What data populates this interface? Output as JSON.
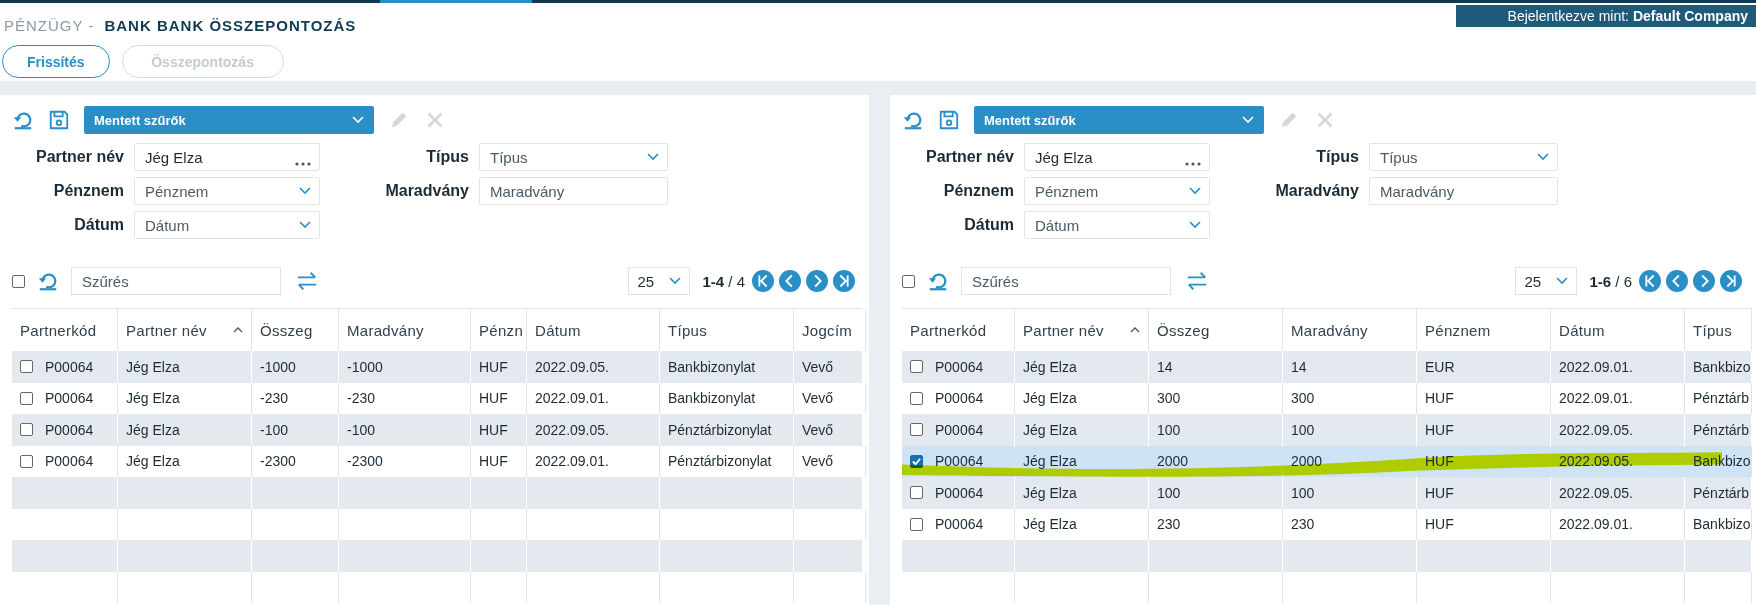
{
  "header": {
    "module": "PÉNZÜGY -",
    "title": "BANK BANK ÖSSZEPONTOZÁS",
    "login_label": "Bejelentkezve mint:",
    "login_user": "Default Company"
  },
  "actions": [
    {
      "label": "Frissítés",
      "disabled": false
    },
    {
      "label": "Összepontozás",
      "disabled": true
    }
  ],
  "panels": [
    {
      "saved_filters": "Mentett szűrők",
      "filters_left": [
        {
          "label": "Partner név",
          "value": "Jég Elza",
          "kind": "lookup"
        },
        {
          "label": "Pénznem",
          "placeholder": "Pénznem",
          "kind": "select"
        },
        {
          "label": "Dátum",
          "placeholder": "Dátum",
          "kind": "select"
        }
      ],
      "filters_right": [
        {
          "label": "Típus",
          "placeholder": "Típus",
          "kind": "select"
        },
        {
          "label": "Maradvány",
          "placeholder": "Maradvány",
          "kind": "text"
        }
      ],
      "all_checked": false,
      "search_placeholder": "Szűrés",
      "page_size": "25",
      "range": "1-4",
      "total": "/ 4",
      "columns": [
        {
          "label": "Partnerkód",
          "sorted": false
        },
        {
          "label": "Partner név",
          "sorted": true
        },
        {
          "label": "Összeg",
          "sorted": false
        },
        {
          "label": "Maradvány",
          "sorted": false
        },
        {
          "label": "Pénzn",
          "sorted": false
        },
        {
          "label": "Dátum",
          "sorted": false
        },
        {
          "label": "Típus",
          "sorted": false
        },
        {
          "label": "Jogcím",
          "sorted": false
        }
      ],
      "rows": [
        {
          "checked": false,
          "marked": false,
          "cells": [
            "P00064",
            "Jég Elza",
            "-1000",
            "-1000",
            "HUF",
            "2022.09.05.",
            "Bankbizonylat",
            "Vevő"
          ]
        },
        {
          "checked": false,
          "marked": false,
          "cells": [
            "P00064",
            "Jég Elza",
            "-230",
            "-230",
            "HUF",
            "2022.09.01.",
            "Bankbizonylat",
            "Vevő"
          ]
        },
        {
          "checked": false,
          "marked": false,
          "cells": [
            "P00064",
            "Jég Elza",
            "-100",
            "-100",
            "HUF",
            "2022.09.05.",
            "Pénztárbizonylat",
            "Vevő"
          ]
        },
        {
          "checked": false,
          "marked": false,
          "cells": [
            "P00064",
            "Jég Elza",
            "-2300",
            "-2300",
            "HUF",
            "2022.09.01.",
            "Pénztárbizonylat",
            "Vevő"
          ]
        }
      ]
    },
    {
      "saved_filters": "Mentett szűrők",
      "filters_left": [
        {
          "label": "Partner név",
          "value": "Jég Elza",
          "kind": "lookup"
        },
        {
          "label": "Pénznem",
          "placeholder": "Pénznem",
          "kind": "select"
        },
        {
          "label": "Dátum",
          "placeholder": "Dátum",
          "kind": "select"
        }
      ],
      "filters_right": [
        {
          "label": "Típus",
          "placeholder": "Típus",
          "kind": "select"
        },
        {
          "label": "Maradvány",
          "placeholder": "Maradvány",
          "kind": "text"
        }
      ],
      "all_checked": false,
      "search_placeholder": "Szűrés",
      "page_size": "25",
      "range": "1-6",
      "total": "/ 6",
      "columns": [
        {
          "label": "Partnerkód",
          "sorted": false
        },
        {
          "label": "Partner név",
          "sorted": true
        },
        {
          "label": "Összeg",
          "sorted": false
        },
        {
          "label": "Maradvány",
          "sorted": false
        },
        {
          "label": "Pénznem",
          "sorted": false
        },
        {
          "label": "Dátum",
          "sorted": false
        },
        {
          "label": "Típus",
          "sorted": false
        }
      ],
      "rows": [
        {
          "checked": false,
          "marked": false,
          "cells": [
            "P00064",
            "Jég Elza",
            "14",
            "14",
            "EUR",
            "2022.09.01.",
            "Bankbizo"
          ]
        },
        {
          "checked": false,
          "marked": false,
          "cells": [
            "P00064",
            "Jég Elza",
            "300",
            "300",
            "HUF",
            "2022.09.01.",
            "Pénztárb"
          ]
        },
        {
          "checked": false,
          "marked": false,
          "cells": [
            "P00064",
            "Jég Elza",
            "100",
            "100",
            "HUF",
            "2022.09.05.",
            "Pénztárb"
          ]
        },
        {
          "checked": true,
          "marked": true,
          "cells": [
            "P00064",
            "Jég Elza",
            "2000",
            "2000",
            "HUF",
            "2022.09.05.",
            "Bankbizo"
          ]
        },
        {
          "checked": false,
          "marked": false,
          "cells": [
            "P00064",
            "Jég Elza",
            "100",
            "100",
            "HUF",
            "2022.09.05.",
            "Pénztárb"
          ]
        },
        {
          "checked": false,
          "marked": false,
          "cells": [
            "P00064",
            "Jég Elza",
            "230",
            "230",
            "HUF",
            "2022.09.01.",
            "Bankbizo"
          ]
        }
      ]
    }
  ]
}
